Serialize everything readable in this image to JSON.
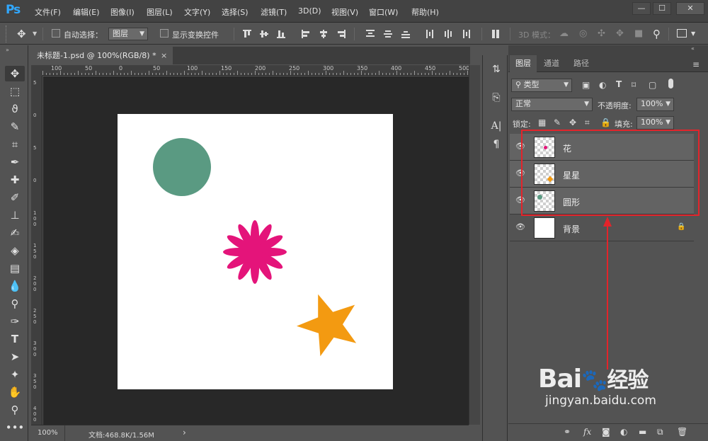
{
  "app": {
    "logo": "Ps"
  },
  "menu": [
    "文件(F)",
    "编辑(E)",
    "图像(I)",
    "图层(L)",
    "文字(Y)",
    "选择(S)",
    "滤镜(T)",
    "3D(D)",
    "视图(V)",
    "窗口(W)",
    "帮助(H)"
  ],
  "window_controls": {
    "minimize": "—",
    "maximize": "☐",
    "close": "✕"
  },
  "options_bar": {
    "auto_select_label": "自动选择：",
    "auto_select_value": "图层",
    "show_transform_label": "显示变换控件",
    "mode_3d_label": "3D 模式："
  },
  "document": {
    "tab_title": "未标题-1.psd @ 100%(RGB/8) *",
    "tab_close": "×",
    "zoom": "100%",
    "doc_size": "文档:468.8K/1.56M",
    "status_arrow": "›",
    "h_ruler_ticks": [
      "100",
      "50",
      "0",
      "50",
      "100",
      "150",
      "200",
      "250",
      "300",
      "350",
      "400",
      "450",
      "500"
    ],
    "v_ruler_ticks": [
      "5",
      "0",
      "5",
      "0",
      "1\n0\n0",
      "1\n5\n0",
      "2\n0\n0",
      "2\n5\n0",
      "3\n0\n0",
      "3\n5\n0",
      "4\n0\n0"
    ]
  },
  "shapes": {
    "circle_color": "#5a9a82",
    "flower_color": "#e4147a",
    "star_color": "#f39a11"
  },
  "layers_panel": {
    "tabs": [
      "图层",
      "通道",
      "路径"
    ],
    "filter_label": "类型",
    "blend_mode": "正常",
    "opacity_label": "不透明度:",
    "opacity_value": "100%",
    "lock_label": "锁定:",
    "fill_label": "填充:",
    "fill_value": "100%",
    "layers": [
      {
        "name": "花",
        "selected": true
      },
      {
        "name": "星星",
        "selected": true
      },
      {
        "name": "圆形",
        "selected": true
      },
      {
        "name": "背景",
        "selected": false,
        "locked": true
      }
    ]
  },
  "annotation": {
    "highlight_color": "#e3242b"
  },
  "watermark": {
    "brand": "Bai",
    "brand_tail": "经验",
    "url": "jingyan.baidu.com"
  }
}
